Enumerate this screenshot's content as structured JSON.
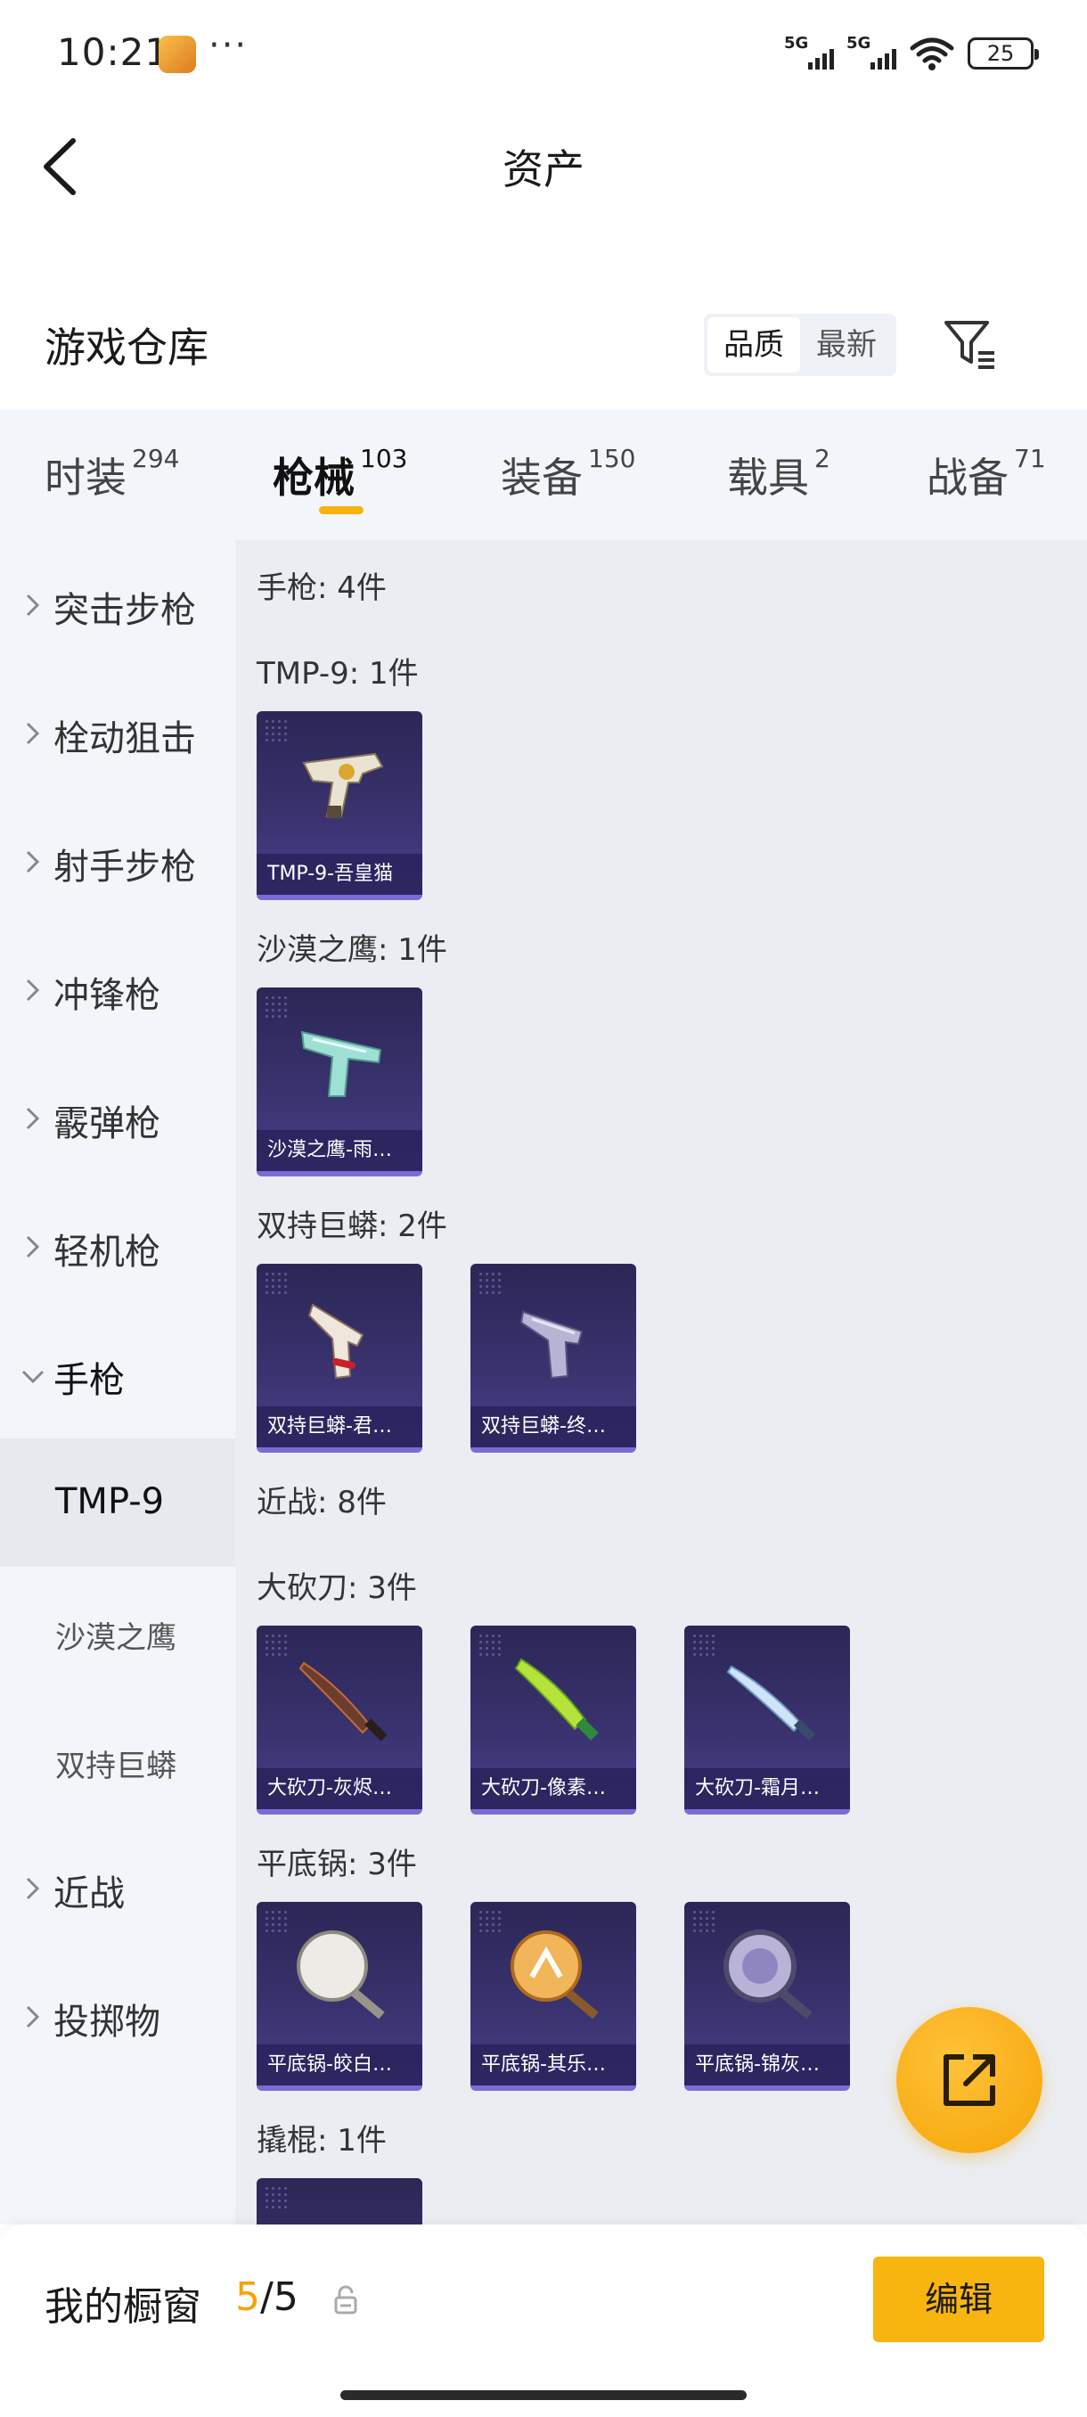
{
  "status_bar": {
    "time": "10:21",
    "more": "···",
    "signal1_label": "5G",
    "signal2_label": "5G",
    "battery": "25"
  },
  "header": {
    "title": "资产"
  },
  "section": {
    "title": "游戏仓库",
    "sort_options": [
      "品质",
      "最新"
    ],
    "sort_selected": "品质"
  },
  "tabs": [
    {
      "label": "时装",
      "count": "294"
    },
    {
      "label": "枪械",
      "count": "103",
      "active": true
    },
    {
      "label": "装备",
      "count": "150"
    },
    {
      "label": "载具",
      "count": "2"
    },
    {
      "label": "战备",
      "count": "71"
    }
  ],
  "sidebar": {
    "items": [
      {
        "label": "突击步枪"
      },
      {
        "label": "栓动狙击"
      },
      {
        "label": "射手步枪"
      },
      {
        "label": "冲锋枪"
      },
      {
        "label": "霰弹枪"
      },
      {
        "label": "轻机枪"
      },
      {
        "label": "手枪",
        "expanded": true
      },
      {
        "label": "TMP-9",
        "sub": true,
        "selected": true
      },
      {
        "label": "沙漠之鹰",
        "sub": true
      },
      {
        "label": "双持巨蟒",
        "sub": true
      },
      {
        "label": "近战"
      },
      {
        "label": "投掷物"
      }
    ]
  },
  "content": {
    "groups": [
      {
        "title": "手枪: 4件",
        "subgroups": [
          {
            "title": "TMP-9: 1件",
            "items": [
              {
                "name": "TMP-9-吾皇猫",
                "icon": "tmp9-gun-icon"
              }
            ]
          },
          {
            "title": "沙漠之鹰: 1件",
            "items": [
              {
                "name": "沙漠之鹰-雨…",
                "icon": "desert-eagle-icon"
              }
            ]
          },
          {
            "title": "双持巨蟒: 2件",
            "items": [
              {
                "name": "双持巨蟒-君…",
                "icon": "python-revolver-icon"
              },
              {
                "name": "双持巨蟒-终…",
                "icon": "python-revolver-icon"
              }
            ]
          }
        ]
      },
      {
        "title": "近战: 8件",
        "subgroups": [
          {
            "title": "大砍刀: 3件",
            "items": [
              {
                "name": "大砍刀-灰烬…",
                "icon": "machete-icon"
              },
              {
                "name": "大砍刀-像素…",
                "icon": "machete-icon"
              },
              {
                "name": "大砍刀-霜月…",
                "icon": "machete-icon"
              }
            ]
          },
          {
            "title": "平底锅: 3件",
            "items": [
              {
                "name": "平底锅-皎白…",
                "icon": "frying-pan-icon"
              },
              {
                "name": "平底锅-其乐…",
                "icon": "frying-pan-icon"
              },
              {
                "name": "平底锅-锦灰…",
                "icon": "frying-pan-icon"
              }
            ]
          },
          {
            "title": "撬棍: 1件",
            "items": []
          }
        ]
      }
    ]
  },
  "bottom_bar": {
    "showcase_label": "我的橱窗",
    "showcase_current": "5",
    "showcase_sep": "/",
    "showcase_total": "5",
    "edit_label": "编辑"
  },
  "colors": {
    "accent": "#f8b40f",
    "tab_indicator": "#f6b30e",
    "card_bg": "#3a3370",
    "card_border": "#7b6bd6",
    "panel_bg": "#eaedf2",
    "sidebar_bg": "#f2f5f9"
  }
}
